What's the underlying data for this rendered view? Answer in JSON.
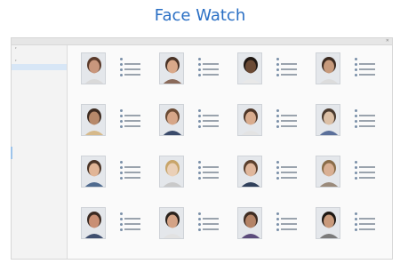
{
  "page_title": "Face Watch",
  "window": {
    "title": "",
    "close_label": "✕"
  },
  "sidebar": {
    "items": [
      {
        "label": "",
        "level": 0
      },
      {
        "label": "",
        "level": 1
      },
      {
        "label": "",
        "level": 0
      },
      {
        "label": "",
        "level": 1,
        "selected": true
      }
    ]
  },
  "faces": [
    {
      "skin": "#c9977d",
      "hair": "#5a3a2a",
      "shirt": "#d9d9d9"
    },
    {
      "skin": "#d9a98a",
      "hair": "#4a3326",
      "shirt": "#8a6a5a"
    },
    {
      "skin": "#6b4a35",
      "hair": "#1f1712",
      "shirt": "#e8e8e8"
    },
    {
      "skin": "#c79a7c",
      "hair": "#3b2a20",
      "shirt": "#dcdcdc"
    },
    {
      "skin": "#b7896a",
      "hair": "#3d2b20",
      "shirt": "#d6b98a"
    },
    {
      "skin": "#d6a688",
      "hair": "#6a4a33",
      "shirt": "#3a4a6a"
    },
    {
      "skin": "#d9ac8e",
      "hair": "#4d3526",
      "shirt": "#e3e3e3"
    },
    {
      "skin": "#dcc0a6",
      "hair": "#4a3a2e",
      "shirt": "#5a6f9a"
    },
    {
      "skin": "#e1b596",
      "hair": "#4a3426",
      "shirt": "#4f6b8f"
    },
    {
      "skin": "#ead0b8",
      "hair": "#c8a56a",
      "shirt": "#c9c9c9"
    },
    {
      "skin": "#e0b79c",
      "hair": "#5a3f2c",
      "shirt": "#2f3f5a"
    },
    {
      "skin": "#d9b094",
      "hair": "#8a6d4a",
      "shirt": "#9a8a7a"
    },
    {
      "skin": "#c98f74",
      "hair": "#3a2a22",
      "shirt": "#3f4f6f"
    },
    {
      "skin": "#d4a386",
      "hair": "#2a221c",
      "shirt": "#e2e2e2"
    },
    {
      "skin": "#b48366",
      "hair": "#3e2c22",
      "shirt": "#5a4a7a"
    },
    {
      "skin": "#c99a7c",
      "hair": "#1e1813",
      "shirt": "#7a7a7a"
    }
  ]
}
